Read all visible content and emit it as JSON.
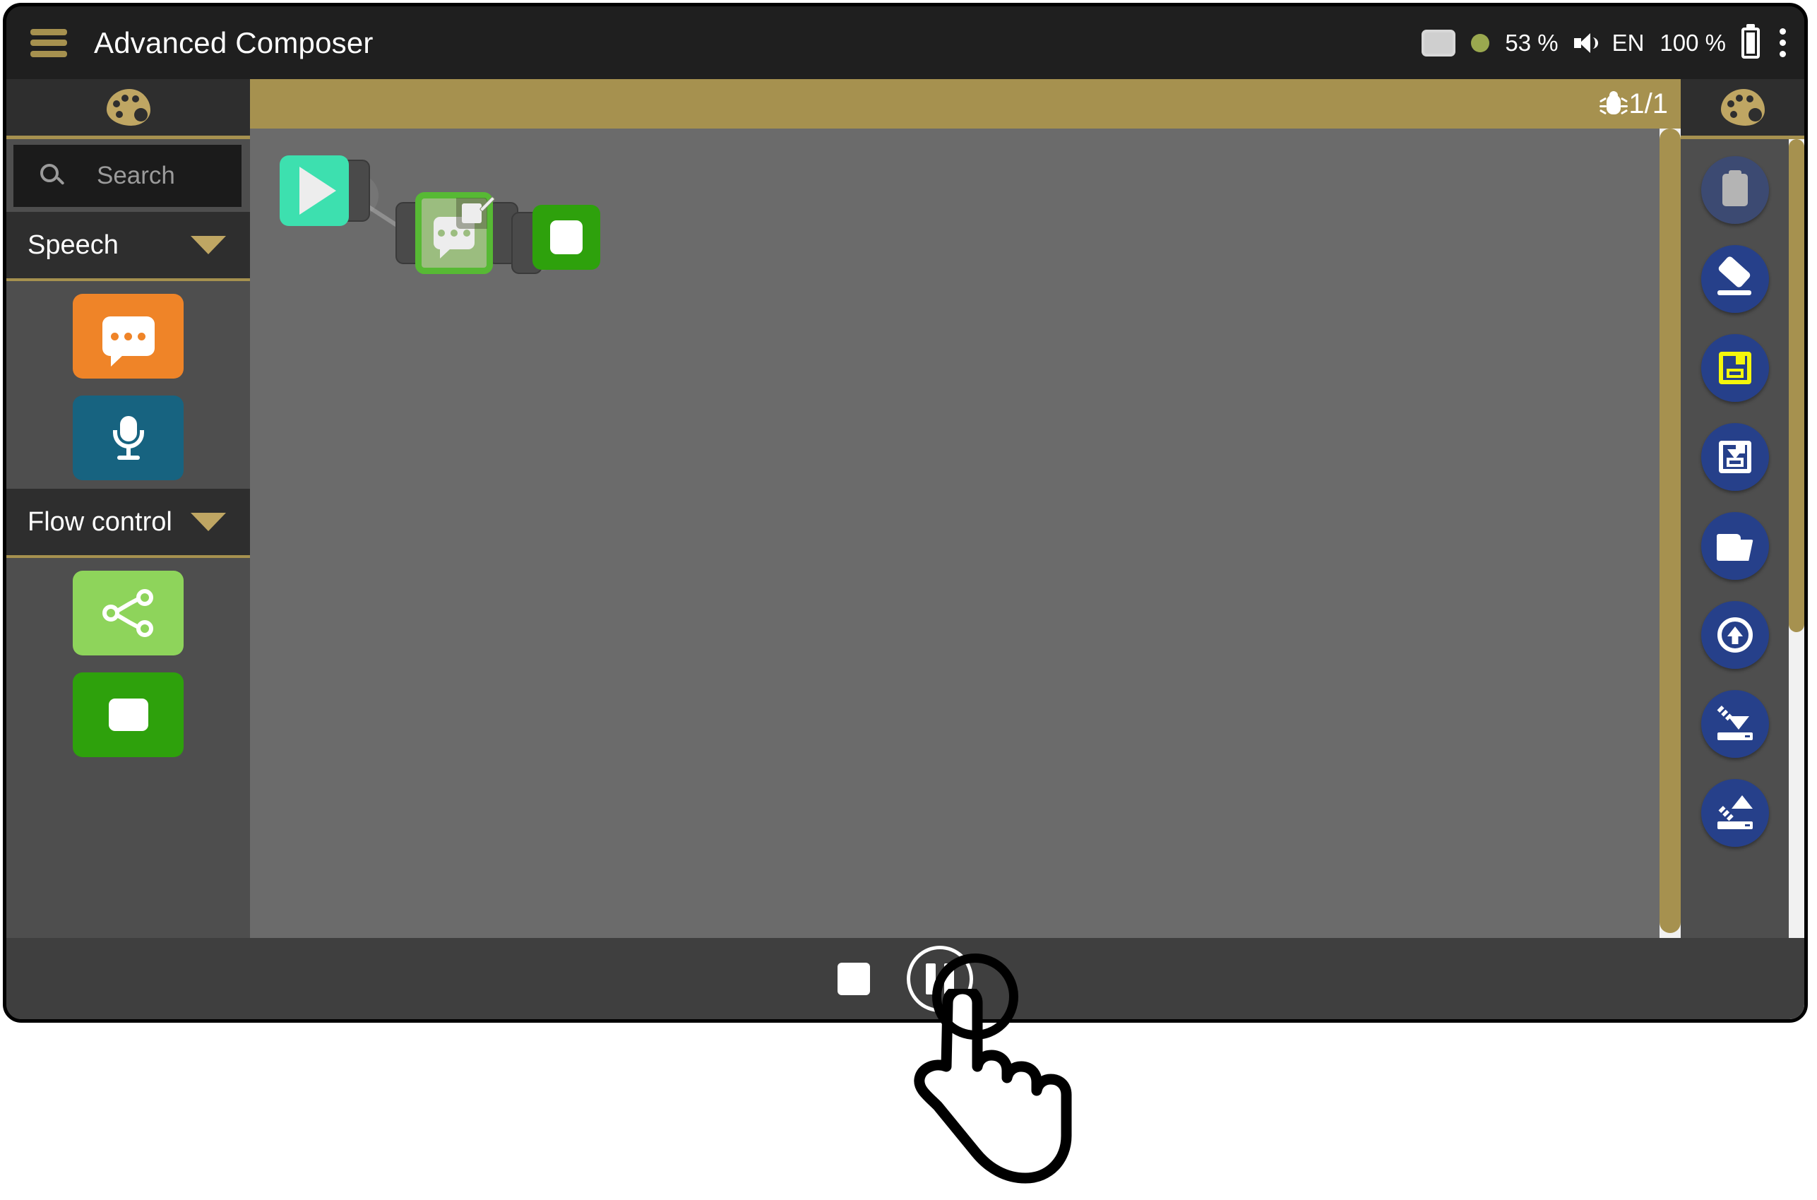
{
  "titlebar": {
    "menu_icon": "hamburger-menu-icon",
    "title": "Advanced Composer",
    "status": {
      "screen_icon": "display-icon",
      "indicator_icon": "status-dot-icon",
      "cpu_percent": "53 %",
      "volume_icon": "speaker-icon",
      "language": "EN",
      "battery_percent": "100 %",
      "battery_icon": "battery-icon",
      "overflow_icon": "kebab-menu-icon"
    }
  },
  "left_panel": {
    "header_icon": "palette-icon",
    "search": {
      "icon": "search-icon",
      "placeholder": "Search",
      "value": ""
    },
    "categories": [
      {
        "label": "Speech",
        "caret": "chevron-down-icon",
        "blocks": [
          {
            "name": "speech-bubble-block",
            "icon": "speech-bubble-icon",
            "color": "#ef8428"
          },
          {
            "name": "microphone-block",
            "icon": "microphone-icon",
            "color": "#176380"
          }
        ]
      },
      {
        "label": "Flow control",
        "caret": "chevron-down-icon",
        "blocks": [
          {
            "name": "branch-block",
            "icon": "branch-icon",
            "color": "#8ed45b"
          },
          {
            "name": "stop-block",
            "icon": "stop-square-icon",
            "color": "#2ea10c"
          }
        ]
      }
    ]
  },
  "canvas": {
    "header": {
      "debug_icon": "bug-icon",
      "page_count": "1/1"
    },
    "nodes": [
      {
        "id": "start",
        "icon": "play-icon",
        "color": "#3de0af",
        "selected": false
      },
      {
        "id": "speech",
        "icon": "speech-bubble-icon",
        "color": "#9bbd7f",
        "selected": true,
        "badge_icon": "edit-pencil-icon"
      },
      {
        "id": "stop",
        "icon": "stop-square-icon",
        "color": "#2ea10c",
        "selected": false
      }
    ],
    "scrollbars": {
      "vertical_color": "#a6914f",
      "horizontal_color": "#a6914f"
    }
  },
  "right_panel": {
    "header_icon": "palette-icon",
    "tools": [
      {
        "name": "paste-button",
        "icon": "clipboard-icon",
        "enabled": false
      },
      {
        "name": "erase-button",
        "icon": "eraser-icon",
        "enabled": true
      },
      {
        "name": "save-button",
        "icon": "floppy-save-icon",
        "enabled": true
      },
      {
        "name": "save-as-button",
        "icon": "floppy-download-icon",
        "enabled": true
      },
      {
        "name": "open-button",
        "icon": "folder-open-icon",
        "enabled": true
      },
      {
        "name": "upload-button",
        "icon": "upload-circle-icon",
        "enabled": true
      },
      {
        "name": "import-button",
        "icon": "import-tray-icon",
        "enabled": true
      },
      {
        "name": "export-button",
        "icon": "export-tray-icon",
        "enabled": true
      }
    ]
  },
  "transport": {
    "stop": {
      "name": "stop-button",
      "icon": "stop-square-icon"
    },
    "pause": {
      "name": "pause-button",
      "icon": "pause-icon"
    }
  },
  "cursor": {
    "icon": "tap-hand-cursor",
    "target": "pause-button"
  },
  "colors": {
    "accent_gold": "#a6914f",
    "panel_dark": "#2e2e2e",
    "panel_mid": "#4e4e4e",
    "canvas": "#6b6b6b",
    "tool_blue": "#26408a"
  }
}
